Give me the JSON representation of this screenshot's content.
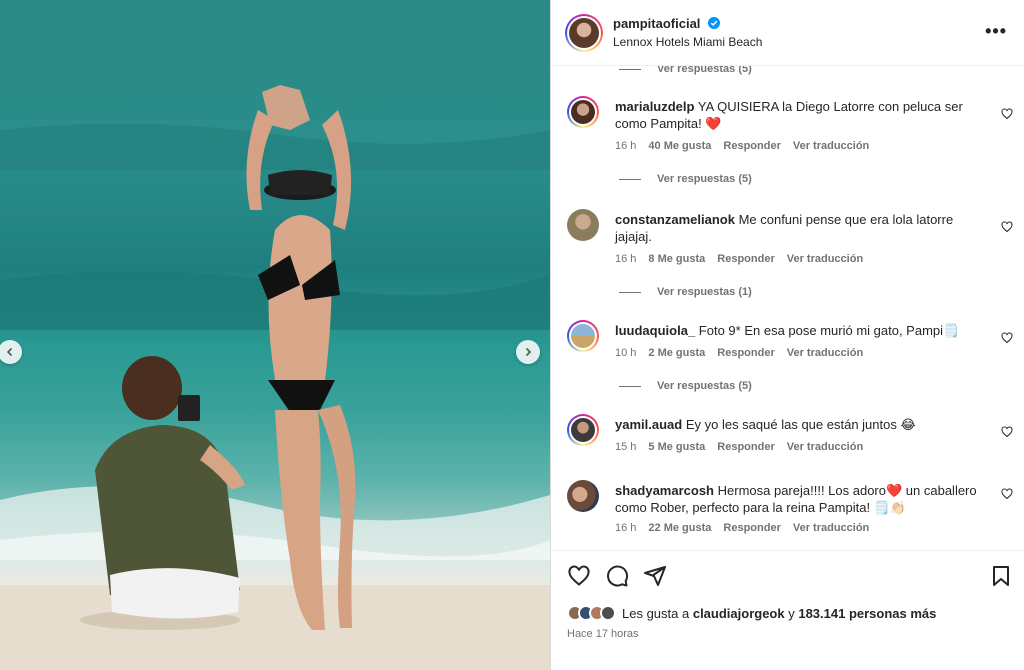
{
  "photo": {
    "prev_icon": "chevron-left-icon",
    "next_icon": "chevron-right-icon"
  },
  "post_header": {
    "username": "pampitaoficial",
    "verified_icon": "verified-badge-icon",
    "location": "Lennox Hotels Miami Beach",
    "more_icon": "more-options-icon",
    "more_label": "•••"
  },
  "comments": {
    "top_replies": "Ver respuestas (5)",
    "items": [
      {
        "username": "marialuzdelp",
        "text": "YA QUISIERA la Diego Latorre con peluca ser como Pampita! ❤️",
        "time": "16 h",
        "likes": "40 Me gusta",
        "reply": "Responder",
        "translate": "Ver traducción",
        "replies": "Ver respuestas (5)"
      },
      {
        "username": "constanzamelianok",
        "text": "Me confuni pense que era lola latorre jajajaj.",
        "time": "16 h",
        "likes": "8 Me gusta",
        "reply": "Responder",
        "translate": "Ver traducción",
        "replies": "Ver respuestas (1)"
      },
      {
        "username": "luudaquiola_",
        "text": "Foto 9* En esa pose murió mi gato, Pampi🗒️",
        "time": "10 h",
        "likes": "2 Me gusta",
        "reply": "Responder",
        "translate": "Ver traducción",
        "replies": "Ver respuestas (5)"
      },
      {
        "username": "yamil.auad",
        "text": "Ey yo les saqué las que están juntos 😂",
        "time": "15 h",
        "likes": "5 Me gusta",
        "reply": "Responder",
        "translate": "Ver traducción"
      },
      {
        "username": "shadyamarcosh",
        "text": "Hermosa pareja!!!! Los adoro❤️ un caballero como Rober, perfecto para la reina Pampita! 🗒️👏🏻",
        "time": "16 h",
        "likes": "22 Me gusta",
        "reply": "Responder",
        "translate": "Ver traducción"
      }
    ]
  },
  "actions": {
    "like_icon": "heart-icon",
    "comment_icon": "comment-icon",
    "share_icon": "share-icon",
    "save_icon": "bookmark-icon",
    "likes_prefix": "Les gusta a",
    "likes_user": "claudiajorgeok",
    "likes_and": "y",
    "likes_others": "183.141 personas más",
    "time_ago": "Hace 17 horas"
  },
  "colors": {
    "text": "#262626",
    "secondary": "#737373",
    "heart_red": "#ed4956",
    "verified_blue": "#0095f6"
  }
}
